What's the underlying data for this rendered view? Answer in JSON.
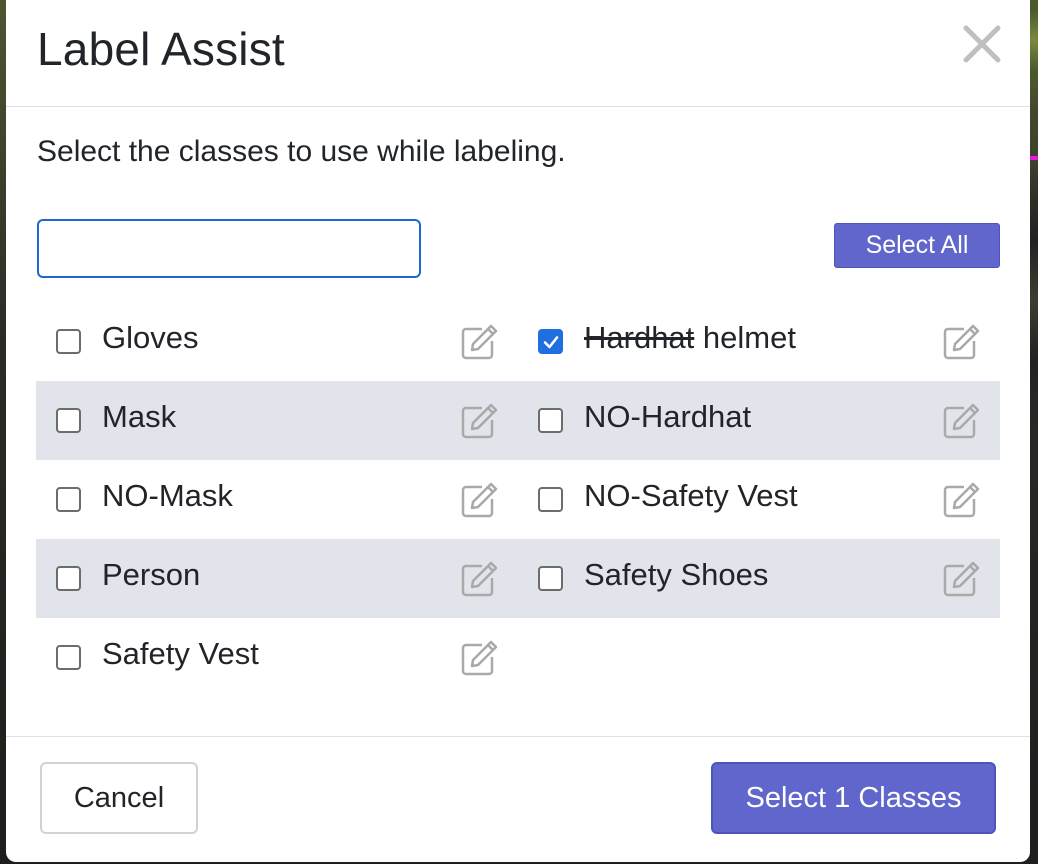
{
  "modal": {
    "title": "Label Assist",
    "close_icon": "close-icon",
    "description": "Select the classes to use while labeling.",
    "search": {
      "value": "",
      "placeholder": ""
    },
    "select_all_label": "Select All",
    "classes": [
      {
        "label": "Gloves",
        "checked": false
      },
      {
        "label_struck": "Hardhat",
        "label_rest": " helmet",
        "checked": true
      },
      {
        "label": "Mask",
        "checked": false
      },
      {
        "label": "NO-Hardhat",
        "checked": false
      },
      {
        "label": "NO-Mask",
        "checked": false
      },
      {
        "label": "NO-Safety Vest",
        "checked": false
      },
      {
        "label": "Person",
        "checked": false
      },
      {
        "label": "Safety Shoes",
        "checked": false
      },
      {
        "label": "Safety Vest",
        "checked": false
      }
    ],
    "cancel_label": "Cancel",
    "submit_label": "Select 1 Classes"
  },
  "colors": {
    "accent": "#6066cb",
    "checkbox_checked": "#1f6fe0",
    "row_shade": "#e1e4ea",
    "search_border": "#1f68c9"
  }
}
